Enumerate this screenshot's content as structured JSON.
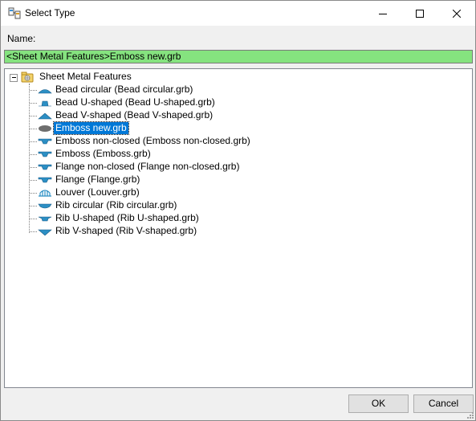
{
  "window": {
    "title": "Select Type"
  },
  "name": {
    "label": "Name:",
    "value": "<Sheet Metal Features>Emboss new.grb"
  },
  "tree": {
    "root": "Sheet Metal Features",
    "items": [
      {
        "label": "Bead circular (Bead circular.grb)",
        "icon": "bead-circular-icon"
      },
      {
        "label": "Bead U-shaped (Bead U-shaped.grb)",
        "icon": "bead-u-shaped-icon"
      },
      {
        "label": "Bead V-shaped (Bead V-shaped.grb)",
        "icon": "bead-v-shaped-icon"
      },
      {
        "label": "Emboss new.grb",
        "icon": "emboss-new-icon",
        "selected": true
      },
      {
        "label": "Emboss non-closed (Emboss non-closed.grb)",
        "icon": "emboss-non-closed-icon"
      },
      {
        "label": "Emboss (Emboss.grb)",
        "icon": "emboss-icon"
      },
      {
        "label": "Flange non-closed (Flange non-closed.grb)",
        "icon": "flange-non-closed-icon"
      },
      {
        "label": "Flange (Flange.grb)",
        "icon": "flange-icon"
      },
      {
        "label": "Louver (Louver.grb)",
        "icon": "louver-icon"
      },
      {
        "label": "Rib circular (Rib circular.grb)",
        "icon": "rib-circular-icon"
      },
      {
        "label": "Rib U-shaped (Rib U-shaped.grb)",
        "icon": "rib-u-shaped-icon"
      },
      {
        "label": "Rib V-shaped (Rib V-shaped.grb)",
        "icon": "rib-v-shaped-icon"
      }
    ]
  },
  "buttons": {
    "ok": "OK",
    "cancel": "Cancel"
  },
  "colors": {
    "name_field_bg": "#85e37f",
    "selection": "#0078d7",
    "icon_blue": "#2c8fc4"
  }
}
